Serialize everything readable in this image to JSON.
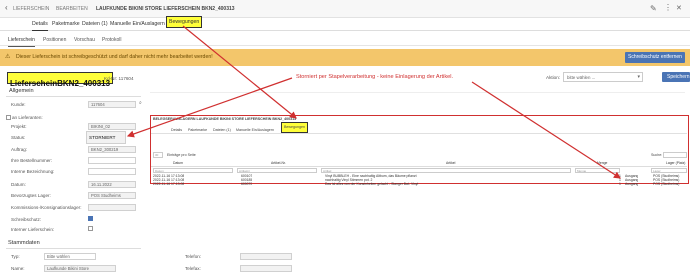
{
  "header": {
    "back_icon": "chevron-left-icon",
    "breadcrumb_section": "LIEFERSCHEIN",
    "breadcrumb_action": "BEARBEITEN",
    "breadcrumb_detail": "LAUFKUNDE BIKINI STORE LIEFERSCHEIN BKN2_400313",
    "icons": [
      "edit-icon",
      "ellipsis-icon",
      "close-icon"
    ]
  },
  "tabs": [
    "Details",
    "Paketmarke",
    "Dateien (1)",
    "Manuelle Ein/Auslagern",
    "Bewegungen"
  ],
  "subtabs": [
    "Lieferschein",
    "Positionen",
    "Vorschau",
    "Protokoll"
  ],
  "warning": {
    "text": "Dieser Lieferschein ist schreibgeschützt und darf daher nicht mehr bearbeitet werden!",
    "button": "Schreibschutz entfernen"
  },
  "document": {
    "title": "LieferscheinBKN2_400313",
    "kd_nr": "Kd-Nr: 117604",
    "annotation": "Storniert per Stapelverarbeitung - keine Einlagerung der Artikel."
  },
  "action": {
    "label": "Aktion:",
    "placeholder": "bitte wählen ...",
    "button": "Speichern"
  },
  "allgemein": {
    "title": "Allgemein",
    "rows": [
      {
        "label": "Kunde:",
        "value": "117604"
      },
      {
        "label": "an Lieferanten:",
        "value": ""
      },
      {
        "label": "Projekt:",
        "value": "BIKINI_02"
      },
      {
        "label": "Status:",
        "value": "STORNIERT"
      },
      {
        "label": "Auftrag:",
        "value": "BKN2_300219"
      },
      {
        "label": "Ihre Bestellnummer:",
        "value": ""
      },
      {
        "label": "Interne Bezeichnung:",
        "value": ""
      },
      {
        "label": "Datum:",
        "value": "16.11.2022"
      },
      {
        "label": "Bevorzugtes Lager:",
        "value": "POS Studheims"
      },
      {
        "label": "Kommissions-/Konsignationslager:",
        "value": ""
      },
      {
        "label": "Schreibschutz:",
        "value": ""
      },
      {
        "label": "Interner Lieferschein:",
        "value": ""
      }
    ]
  },
  "inner": {
    "breadcrumb": "BELEGSERAUSLAGERN LAUFKUNDE BIKINI STORE LIEFERSCHEIN BKN2_400313",
    "tabs": [
      "Details",
      "Paketmarke",
      "Dateien (1)",
      "Manuelle Ein/Auslagern",
      "Bewegungen"
    ],
    "page_size": "30",
    "page_size_label": "Einträge pro Seite",
    "search_label": "Suche:",
    "columns": [
      "Datum",
      "Artikel-Nr.",
      "Artikel",
      "Menge",
      "Lager (Platz)"
    ],
    "filters": [
      "Datum",
      "Artikelnr",
      "Artikel",
      "Menge",
      "Lager"
    ],
    "rows": [
      {
        "date": "2022-11-16 17:13:08",
        "nr": "600107",
        "artikel": "Vinyl BUBBLEH - Eine nachhaltig Altbum, das Bäume pflanzt",
        "menge": "1",
        "typ": "Ausgang",
        "lager": "POS (Studheims)"
      },
      {
        "date": "2022-11-16 17:13:08",
        "nr": "600185",
        "artikel": "nachhaltig Vinyl Stimmen pot. 2",
        "menge": "1",
        "typ": "Ausgang",
        "lager": "POS (Studheims)"
      },
      {
        "date": "2022-11-16 17:13:08",
        "nr": "600070",
        "artikel": "Das ist alles von der Kunstnheiten gelacht - Slanger Bat- Vinyl",
        "menge": "1",
        "typ": "Ausgang",
        "lager": "POS (Studheims)"
      }
    ]
  },
  "stammdaten": {
    "title": "Stammdaten",
    "typ_label": "Typ:",
    "typ_value": "Bitte wählen",
    "name_label": "Name:",
    "name_value": "Laufkunde Bikini Store",
    "telefon_label": "Telefon:",
    "telefax_label": "Telefax:"
  },
  "colors": {
    "highlight": "#ffff3a",
    "annotation": "#d03030",
    "warning": "#f3c66b",
    "primary": "#4a74b5"
  }
}
